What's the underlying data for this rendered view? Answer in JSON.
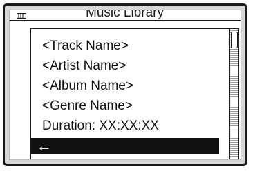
{
  "background": {
    "title": "Music Library"
  },
  "popup": {
    "items": [
      "<Track Name>",
      "<Artist Name>",
      "<Album Name>",
      "<Genre Name>",
      "Duration: XX:XX:XX"
    ],
    "selected_row": {
      "label": "←",
      "icon": "left-arrow-icon"
    }
  }
}
